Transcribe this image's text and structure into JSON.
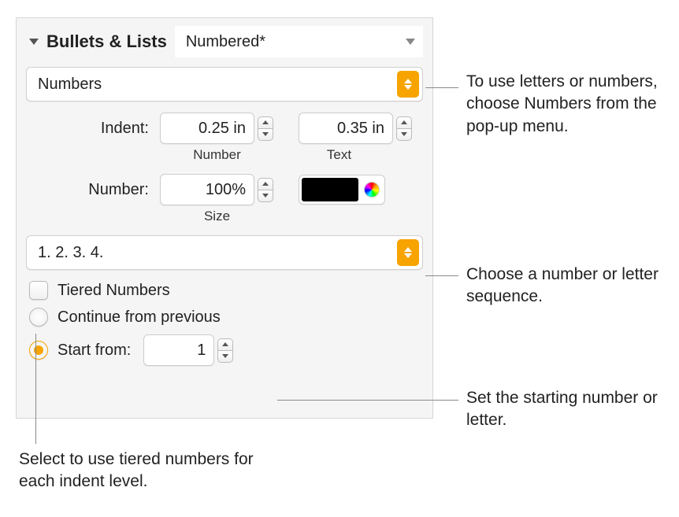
{
  "header": {
    "section_title": "Bullets & Lists",
    "style_value": "Numbered*"
  },
  "type_popup_value": "Numbers",
  "indent": {
    "label": "Indent:",
    "number_value": "0.25 in",
    "number_caption": "Number",
    "text_value": "0.35 in",
    "text_caption": "Text"
  },
  "number": {
    "label": "Number:",
    "size_value": "100%",
    "size_caption": "Size"
  },
  "sequence_popup_value": "1. 2. 3. 4.",
  "tiered_label": "Tiered Numbers",
  "continue_label": "Continue from previous",
  "start_from_label": "Start from:",
  "start_from_value": "1",
  "callouts": {
    "type": "To use letters or numbers, choose Numbers from the pop-up menu.",
    "sequence": "Choose a number or letter sequence.",
    "start": "Set the starting number or letter.",
    "tiered": "Select to use tiered numbers for each indent level."
  }
}
